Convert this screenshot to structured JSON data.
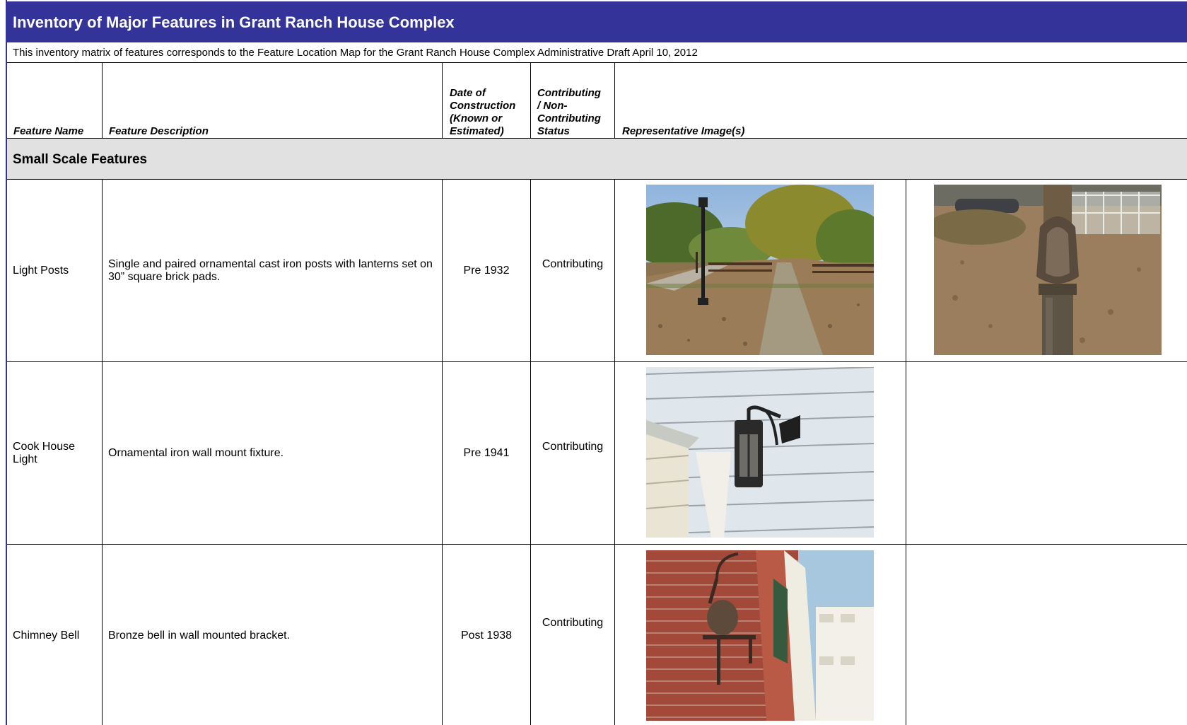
{
  "title": "Inventory of Major Features in Grant Ranch House Complex",
  "subtitle": "This inventory matrix of features corresponds to the Feature Location Map for the Grant Ranch House Complex  Administrative Draft April 10, 2012",
  "headers": {
    "feature_name": "Feature Name",
    "feature_description": "Feature Description",
    "date_line1": "Date of",
    "date_line2": "Construction",
    "date_line3": "(Known or",
    "date_line4": "Estimated)",
    "status_line1": "Contributing",
    "status_line2": "/ Non-",
    "status_line3": "Contributing",
    "status_line4": "Status",
    "images": "Representative Image(s)"
  },
  "section": "Small Scale Features",
  "rows": [
    {
      "name": "Light Posts",
      "description_line1": "Single and paired ornamental cast iron posts with lanterns set on",
      "description_line2": "30” square brick pads.",
      "date": "Pre 1932",
      "status": "Contributing",
      "image_1": "photo-light-post-path",
      "image_2": "photo-light-post-base"
    },
    {
      "name_line1": "Cook House",
      "name_line2": "Light",
      "description": "Ornamental iron wall mount fixture.",
      "date": "Pre 1941",
      "status": "Contributing",
      "image_1": "photo-wall-lantern"
    },
    {
      "name": "Chimney Bell",
      "description": "Bronze bell in wall mounted bracket.",
      "date": "Post 1938",
      "status": "Contributing",
      "image_1": "photo-chimney-bell"
    }
  ],
  "colors": {
    "title_bar": "#33339a",
    "section_band": "#e1e1e1"
  }
}
